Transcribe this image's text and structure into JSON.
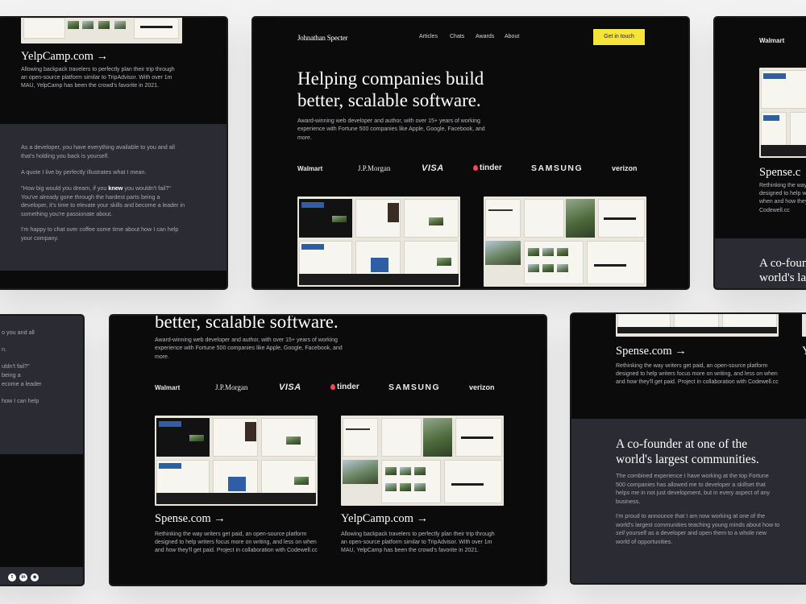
{
  "brand": "Johnathan Specter",
  "nav": {
    "items": [
      "Articles",
      "Chats",
      "Awards",
      "About"
    ],
    "cta": "Get in touch"
  },
  "hero": {
    "headline": [
      "Helping companies build",
      "better, scalable software."
    ],
    "headline_second_line": "better, scalable software.",
    "subtitle": "Award-winning web developer and author, with over 15+ years of working experience with Fortune 500 companies like Apple, Google, Facebook, and more."
  },
  "logos": [
    "Walmart",
    "J.P.Morgan",
    "VISA",
    "tinder",
    "SAMSUNG",
    "verizon"
  ],
  "projects": {
    "yelpcamp": {
      "title": "YelpCamp.com →",
      "description": "Allowing backpack travelers to perfectly plan their trip through an open-source platform similar to TripAdvisor. With over 1m MAU, YelpCamp has been the crowd's favorite in 2021."
    },
    "spense": {
      "title": "Spense.com →",
      "description_parts": [
        "Rethinking the way writers get paid, an open-source platform designed to help writers focus more on writing, and less on when and ",
        "how",
        " they'll get paid. Project in collaboration with Codewell.cc"
      ],
      "title_short": "Spense.c",
      "desc_short_lines": [
        "Rethinking the way",
        "designed to help wr",
        "when and how they",
        "Codewell.cc"
      ]
    }
  },
  "about": {
    "p1": "As a developer, you have everything available to you and all that's holding you back is yourself.",
    "p2": "A quote I live by perfectly illustrates what I mean.",
    "p3_before": "\"How big would you dream, if you ",
    "p3_bold": "knew",
    "p3_after": " you wouldn't fail?\" You've already gone through the hardest parts being a developer, it's time to elevate your skills and become a leader in something you're passionate about.",
    "p4": "I'm happy to chat over coffee some time about how I can help your company.",
    "crop_lines": [
      "o you and all",
      "",
      "n.",
      "",
      "uldn't fail?\"",
      "being a",
      "ecome a leader",
      "",
      "how I can help"
    ]
  },
  "cofounder": {
    "heading": [
      "A co-founder at one of the",
      "world's largest communities."
    ],
    "heading_crop": [
      "A co-foun",
      "world's la"
    ],
    "p1": "The combined experience I have working at the top Fortune 500 companies has allowed me to developer a skillset that helps me in not just development, but in every aspect of any business.",
    "p2_before": "I'm proud to announce that I am now working at one of the world's largest communities teaching young minds about how to ",
    "p2_em": "sell",
    "p2_after": " yourself as a developer and open them to a whole new world of opportunities."
  },
  "social_icons": [
    "twitter-icon",
    "linkedin-icon",
    "github-icon"
  ],
  "colors": {
    "background": "#f2f2f2",
    "card": "#0b0b0c",
    "panel": "#2b2b33",
    "accent_yellow": "#f7e43a",
    "tinder": "#ff4458"
  }
}
